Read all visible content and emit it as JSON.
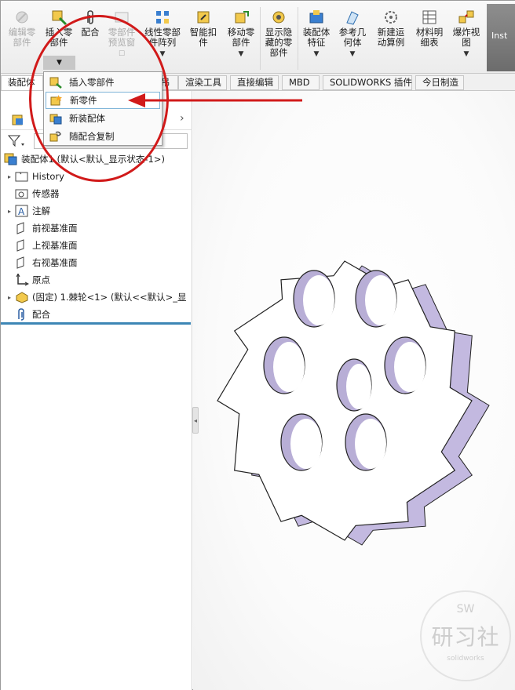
{
  "ribbon": {
    "buttons": [
      {
        "label": "编辑零\n部件",
        "icon": "edit-component-icon",
        "disabled": true
      },
      {
        "label": "插入零\n部件",
        "icon": "insert-component-icon",
        "disabled": false
      },
      {
        "label": "配合",
        "icon": "mate-paperclip-icon",
        "disabled": false
      },
      {
        "label": "零部件\n预览窗",
        "icon": "component-preview-icon",
        "disabled": true
      },
      {
        "label": "线性零部\n件阵列",
        "icon": "linear-pattern-icon",
        "disabled": false
      },
      {
        "label": "智能扣\n件",
        "icon": "smart-fastener-icon",
        "disabled": false
      },
      {
        "label": "移动零\n部件",
        "icon": "move-component-icon",
        "disabled": false
      },
      {
        "label": "显示隐\n藏的零\n部件",
        "icon": "show-hidden-icon",
        "disabled": false
      },
      {
        "label": "装配体\n特征",
        "icon": "assembly-feature-icon",
        "disabled": false
      },
      {
        "label": "参考几\n何体",
        "icon": "reference-geometry-icon",
        "disabled": false
      },
      {
        "label": "新建运\n动算例",
        "icon": "motion-study-icon",
        "disabled": false
      },
      {
        "label": "材料明\n细表",
        "icon": "bom-icon",
        "disabled": false
      },
      {
        "label": "爆炸视\n图",
        "icon": "exploded-view-icon",
        "disabled": false
      }
    ],
    "instant3d": "Inst"
  },
  "tabs": [
    "装配体",
    "渲染工具",
    "直接编辑",
    "MBD",
    "SOLIDWORKS 插件",
    "今日制造"
  ],
  "tabs_hidden_suffix": "吊",
  "popup": {
    "items": [
      {
        "label": "插入零部件",
        "icon": "insert-component-icon"
      },
      {
        "label": "新零件",
        "icon": "new-part-icon"
      },
      {
        "label": "新装配体",
        "icon": "new-assembly-icon"
      },
      {
        "label": "随配合复制",
        "icon": "copy-with-mates-icon"
      }
    ],
    "highlighted": "新零件"
  },
  "feature_tree": {
    "root": "装配体1 (默认<默认_显示状态-1>)",
    "items": [
      {
        "label": "History",
        "icon": "history-folder-icon",
        "expandable": true
      },
      {
        "label": "传感器",
        "icon": "sensor-folder-icon",
        "expandable": false
      },
      {
        "label": "注解",
        "icon": "annotation-icon",
        "expandable": true
      },
      {
        "label": "前视基准面",
        "icon": "plane-icon",
        "expandable": false
      },
      {
        "label": "上视基准面",
        "icon": "plane-icon",
        "expandable": false
      },
      {
        "label": "右视基准面",
        "icon": "plane-icon",
        "expandable": false
      },
      {
        "label": "原点",
        "icon": "origin-icon",
        "expandable": false
      },
      {
        "label": "(固定) 1.棘轮<1> (默认<<默认>_显",
        "icon": "part-icon",
        "expandable": true
      },
      {
        "label": "配合",
        "icon": "mates-folder-icon",
        "expandable": false
      }
    ]
  },
  "watermark": {
    "line1": "SW",
    "line2": "研习社",
    "line3": "solidworks"
  },
  "colors": {
    "annotation": "#d11a1a",
    "hole_shade": "#b8aed6",
    "rim_shade": "#c3b9e0",
    "tree_separator": "#3d86b5"
  }
}
